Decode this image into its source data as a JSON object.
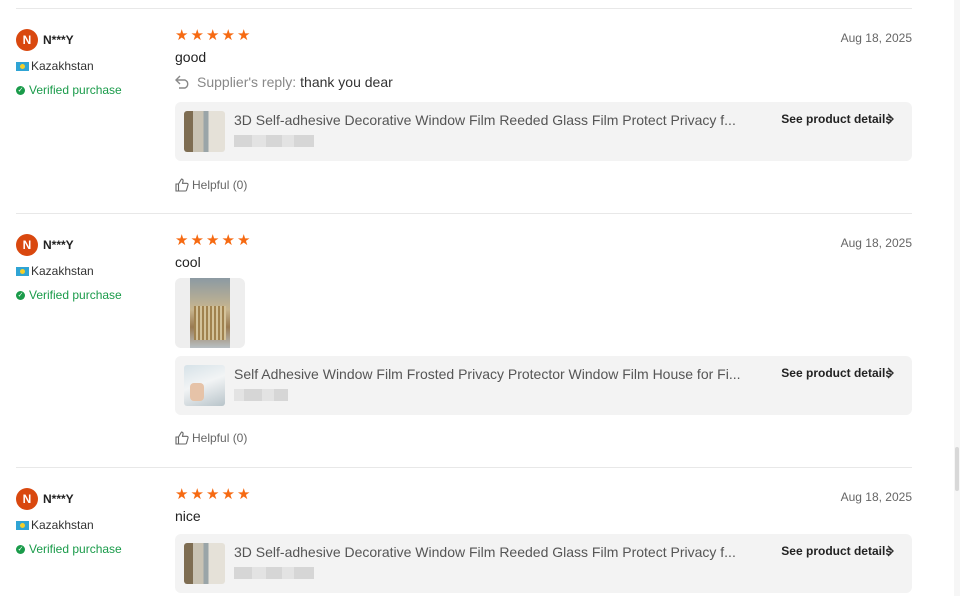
{
  "reviews": [
    {
      "avatar_letter": "N",
      "buyer": "N***Y",
      "country": "Kazakhstan",
      "verified": "Verified purchase",
      "rating": 5,
      "date": "Aug 18, 2025",
      "text": "good",
      "reply_label": "Supplier's reply:",
      "reply_text": "thank you dear",
      "product_title": "3D Self-adhesive Decorative Window Film Reeded Glass Film Protect Privacy f...",
      "details_label": "See product details",
      "helpful": "Helpful (0)"
    },
    {
      "avatar_letter": "N",
      "buyer": "N***Y",
      "country": "Kazakhstan",
      "verified": "Verified purchase",
      "rating": 5,
      "date": "Aug 18, 2025",
      "text": "cool",
      "product_title": "Self Adhesive Window Film Frosted Privacy Protector Window Film House for Fi...",
      "details_label": "See product details",
      "helpful": "Helpful (0)"
    },
    {
      "avatar_letter": "N",
      "buyer": "N***Y",
      "country": "Kazakhstan",
      "verified": "Verified purchase",
      "rating": 5,
      "date": "Aug 18, 2025",
      "text": "nice",
      "product_title": "3D Self-adhesive Decorative Window Film Reeded Glass Film Protect Privacy f...",
      "details_label": "See product details"
    }
  ],
  "colors": {
    "star": "#f66a12",
    "avatar": "#d9480f",
    "verified": "#1a9b4a",
    "card_bg": "#f3f3f3"
  },
  "icons": {
    "reply": "reply-arrow-icon",
    "helpful": "thumbs-up-icon",
    "details": "chevron-right-icon",
    "verified": "check-circle-icon"
  }
}
